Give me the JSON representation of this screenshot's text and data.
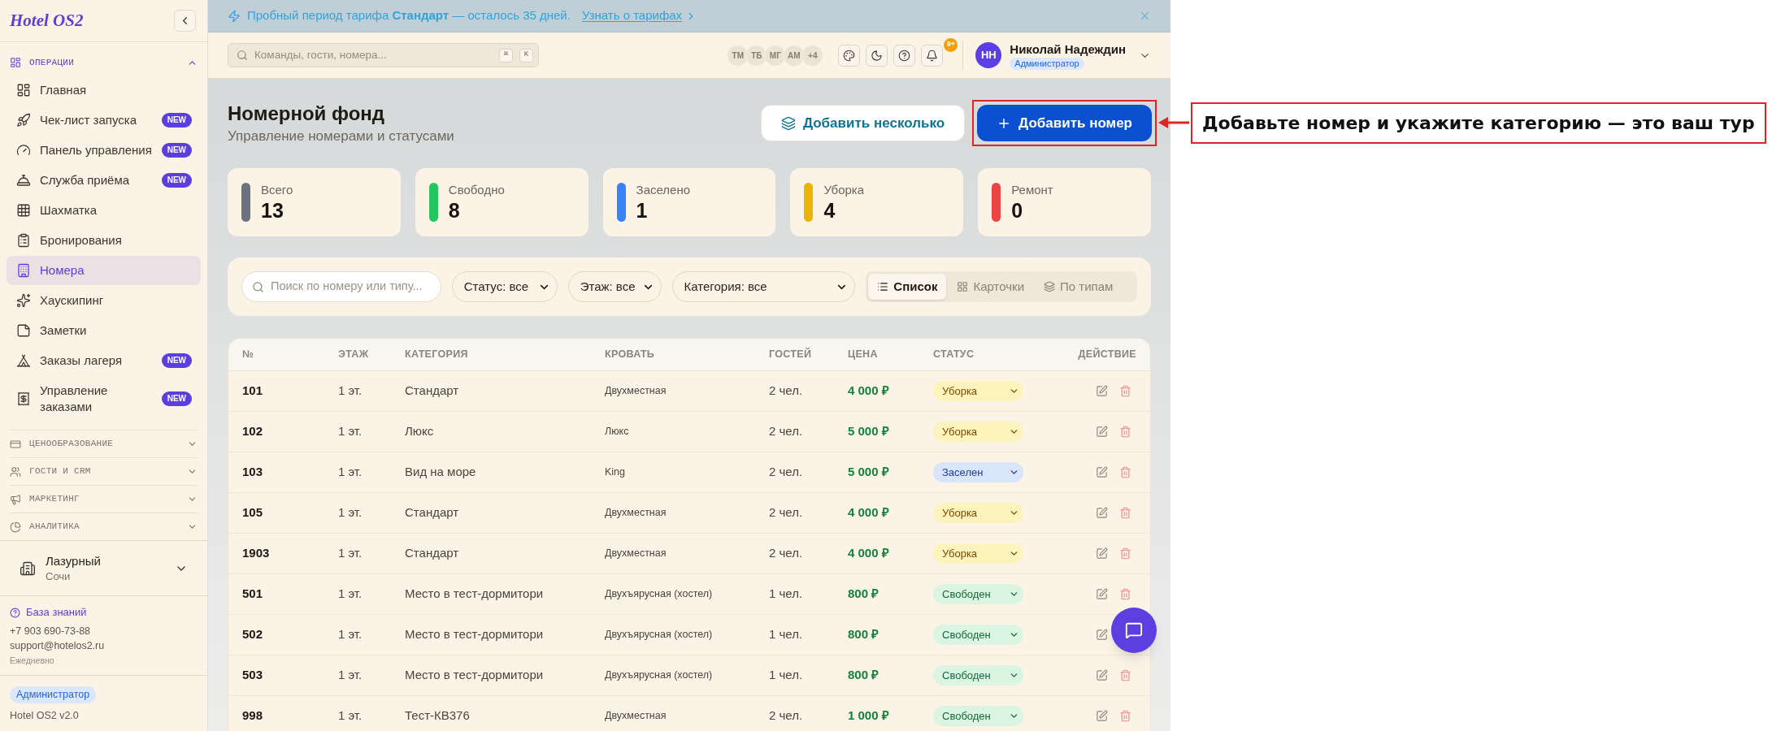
{
  "sidebar": {
    "logo": "Hotel OS2",
    "sections": [
      {
        "title": "ОПЕРАЦИИ",
        "expanded": true,
        "items": [
          {
            "label": "Главная",
            "selected": false
          },
          {
            "label": "Чек-лист запуска",
            "badge": "NEW",
            "selected": false
          },
          {
            "label": "Панель управления",
            "badge": "NEW",
            "selected": false
          },
          {
            "label": "Служба приёма",
            "badge": "NEW",
            "selected": false
          },
          {
            "label": "Шахматка",
            "selected": false
          },
          {
            "label": "Бронирования",
            "selected": false
          },
          {
            "label": "Номера",
            "selected": true
          },
          {
            "label": "Хаускипинг",
            "selected": false
          },
          {
            "label": "Заметки",
            "selected": false
          },
          {
            "label": "Заказы лагеря",
            "badge": "NEW",
            "selected": false
          },
          {
            "label": "Управление заказами",
            "badge": "NEW",
            "selected": false
          }
        ]
      },
      {
        "title": "ЦЕНООБРАЗОВАНИЕ",
        "expanded": false
      },
      {
        "title": "ГОСТИ И CRM",
        "expanded": false
      },
      {
        "title": "МАРКЕТИНГ",
        "expanded": false
      },
      {
        "title": "АНАЛИТИКА",
        "expanded": false
      }
    ],
    "hotel": {
      "name": "Лазурный",
      "city": "Сочи"
    },
    "help": {
      "link": "База знаний",
      "phone": "+7 903 690-73-88",
      "email": "support@hotelos2.ru",
      "hours": "Ежедневно"
    },
    "footer": {
      "role": "Администратор",
      "version": "Hotel OS2 v2.0"
    }
  },
  "banner": {
    "text": "Пробный период тарифа **Стандарт** — осталось 35 дней.",
    "link": "Узнать о тарифах"
  },
  "topbar": {
    "search": {
      "placeholder": "Команды, гости, номера...",
      "keys": [
        "⌘",
        "K"
      ]
    },
    "avatars": [
      "ТМ",
      "ТБ",
      "МГ",
      "АМ"
    ],
    "more_users": "+4",
    "notifications": "9+",
    "user": {
      "initials": "НН",
      "name": "Николай Надеждин",
      "role": "Администратор"
    }
  },
  "page": {
    "title": "Номерной фонд",
    "subtitle": "Управление номерами и статусами",
    "actions": [
      {
        "label": "Добавить несколько",
        "kind": "secondary",
        "highlighted": false
      },
      {
        "label": "Добавить номер",
        "kind": "primary",
        "highlighted": true
      }
    ]
  },
  "stats": [
    {
      "label": "Всего",
      "value": "13",
      "color": "#6b7280"
    },
    {
      "label": "Свободно",
      "value": "8",
      "color": "#22c55e"
    },
    {
      "label": "Заселено",
      "value": "1",
      "color": "#3b82f6"
    },
    {
      "label": "Уборка",
      "value": "4",
      "color": "#eab308"
    },
    {
      "label": "Ремонт",
      "value": "0",
      "color": "#ef4444"
    }
  ],
  "filters": {
    "search": {
      "placeholder": "Поиск по номеру или типу..."
    },
    "selects": [
      "Статус: все",
      "Этаж: все",
      "Категория: все"
    ],
    "views": [
      {
        "label": "Список",
        "selected": true
      },
      {
        "label": "Карточки",
        "selected": false
      },
      {
        "label": "По типам",
        "selected": false
      }
    ]
  },
  "table": {
    "columns": [
      "№",
      "ЭТАЖ",
      "КАТЕГОРИЯ",
      "КРОВАТЬ",
      "ГОСТЕЙ",
      "ЦЕНА",
      "СТАТУС",
      "ДЕЙСТВИЕ"
    ],
    "rows": [
      {
        "number": "101",
        "floor": "1 эт.",
        "category": "Стандарт",
        "bed": "Двухместная",
        "guests": "2 чел.",
        "price": "4 000 ₽",
        "status": {
          "label": "Уборка",
          "kind": "cleaning"
        }
      },
      {
        "number": "102",
        "floor": "1 эт.",
        "category": "Люкс",
        "bed": "Люкс",
        "guests": "2 чел.",
        "price": "5 000 ₽",
        "status": {
          "label": "Уборка",
          "kind": "cleaning"
        }
      },
      {
        "number": "103",
        "floor": "1 эт.",
        "category": "Вид на море",
        "bed": "King",
        "guests": "2 чел.",
        "price": "5 000 ₽",
        "status": {
          "label": "Заселен",
          "kind": "occupied"
        }
      },
      {
        "number": "105",
        "floor": "1 эт.",
        "category": "Стандарт",
        "bed": "Двухместная",
        "guests": "2 чел.",
        "price": "4 000 ₽",
        "status": {
          "label": "Уборка",
          "kind": "cleaning"
        }
      },
      {
        "number": "1903",
        "floor": "1 эт.",
        "category": "Стандарт",
        "bed": "Двухместная",
        "guests": "2 чел.",
        "price": "4 000 ₽",
        "status": {
          "label": "Уборка",
          "kind": "cleaning"
        }
      },
      {
        "number": "501",
        "floor": "1 эт.",
        "category": "Место в тест-дормитори",
        "bed": "Двухъярусная (хостел)",
        "guests": "1 чел.",
        "price": "800 ₽",
        "status": {
          "label": "Свободен",
          "kind": "free"
        }
      },
      {
        "number": "502",
        "floor": "1 эт.",
        "category": "Место в тест-дормитори",
        "bed": "Двухъярусная (хостел)",
        "guests": "1 чел.",
        "price": "800 ₽",
        "status": {
          "label": "Свободен",
          "kind": "free"
        }
      },
      {
        "number": "503",
        "floor": "1 эт.",
        "category": "Место в тест-дормитори",
        "bed": "Двухъярусная (хостел)",
        "guests": "1 чел.",
        "price": "800 ₽",
        "status": {
          "label": "Свободен",
          "kind": "free"
        }
      },
      {
        "number": "998",
        "floor": "1 эт.",
        "category": "Тест-КВ376",
        "bed": "Двухместная",
        "guests": "2 чел.",
        "price": "1 000 ₽",
        "status": {
          "label": "Свободен",
          "kind": "free"
        }
      }
    ]
  },
  "tour": {
    "text": "Добавьте номер и укажите категорию — это ваш тур"
  }
}
